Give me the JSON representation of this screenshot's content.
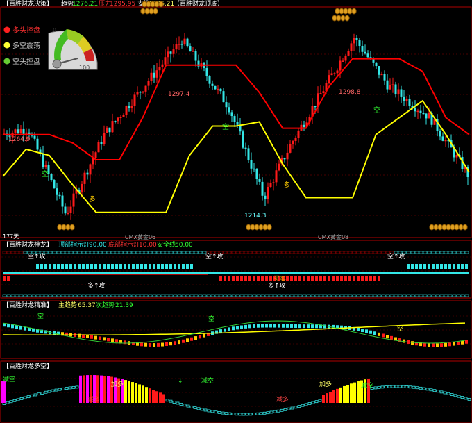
{
  "main_panel": {
    "title": "【百胜财龙决策】",
    "trend_label": "趋势",
    "trend_value": "1276.21",
    "pressure_label": "压力",
    "pressure_value": "1295.95",
    "support_label": "支撑",
    "support_value": "1276.21",
    "top_bottom_label": "【百胜财龙顶底】",
    "legend": [
      {
        "label": "多头控盘",
        "color": "#ff2020"
      },
      {
        "label": "多空震荡",
        "color": "#ffff33"
      },
      {
        "label": "空头控盘",
        "color": "#66cc33"
      }
    ],
    "gauge": {
      "min": "0",
      "max": "100"
    },
    "price_high_1": "1297.4",
    "price_high_2": "1298.8",
    "price_left": "1264.9",
    "price_low": "1214.3",
    "days_label": "177天",
    "contract_1": "CMX黄金06",
    "contract_2": "CMX黄金08",
    "signal_kong": "空",
    "signal_duo": "多"
  },
  "panel2": {
    "title": "【百胜财龙神龙】",
    "top_indicator_label": "顶部指示灯",
    "top_indicator_value": "90.00",
    "bottom_indicator_label": "底部指示灯",
    "bottom_indicator_value": "10.00",
    "safe_line_label": "安全线",
    "safe_line_value": "50.00",
    "sig_kong_attack": "空↑攻",
    "sig_duo_attack": "多↑攻",
    "sig_buy_sell": "买卖"
  },
  "panel3": {
    "title": "【百胜财龙精准】",
    "main_trend_label": "主趋势",
    "main_trend_value": "65.37",
    "sub_trend_label": "次趋势",
    "sub_trend_value": "21.39",
    "sig_kong": "空"
  },
  "panel4": {
    "title": "【百胜财龙多空】",
    "sig_reduce": "减空",
    "sig_add_long": "加多",
    "sig_reduce_long": "减多",
    "sig_arrow": "↓"
  },
  "colors": {
    "bull": "#ff1a1a",
    "bear": "#33e6e6",
    "yellow_line": "#ffff00",
    "red_line": "#ff0000",
    "green_line": "#33cc33",
    "magenta": "#ff00ff",
    "grid": "#5a0000",
    "border": "#b00000"
  },
  "chart_data": [
    {
      "type": "candlestick",
      "title": "【百胜财龙决策】",
      "ylim": [
        1205,
        1310
      ],
      "annotations": [
        "1297.4",
        "1298.8",
        "1264.9",
        "1214.3"
      ],
      "series": [
        {
          "name": "red_line",
          "values": [
            1252,
            1252,
            1252,
            1248,
            1240,
            1240,
            1260,
            1285,
            1285,
            1285,
            1285,
            1272,
            1255,
            1255,
            1275,
            1288,
            1288,
            1288,
            1282,
            1260,
            1252
          ]
        },
        {
          "name": "yellow_line",
          "values": [
            1232,
            1245,
            1242,
            1228,
            1215,
            1215,
            1215,
            1215,
            1242,
            1256,
            1256,
            1258,
            1238,
            1222,
            1222,
            1222,
            1252,
            1260,
            1268,
            1252,
            1234
          ]
        }
      ]
    }
  ]
}
